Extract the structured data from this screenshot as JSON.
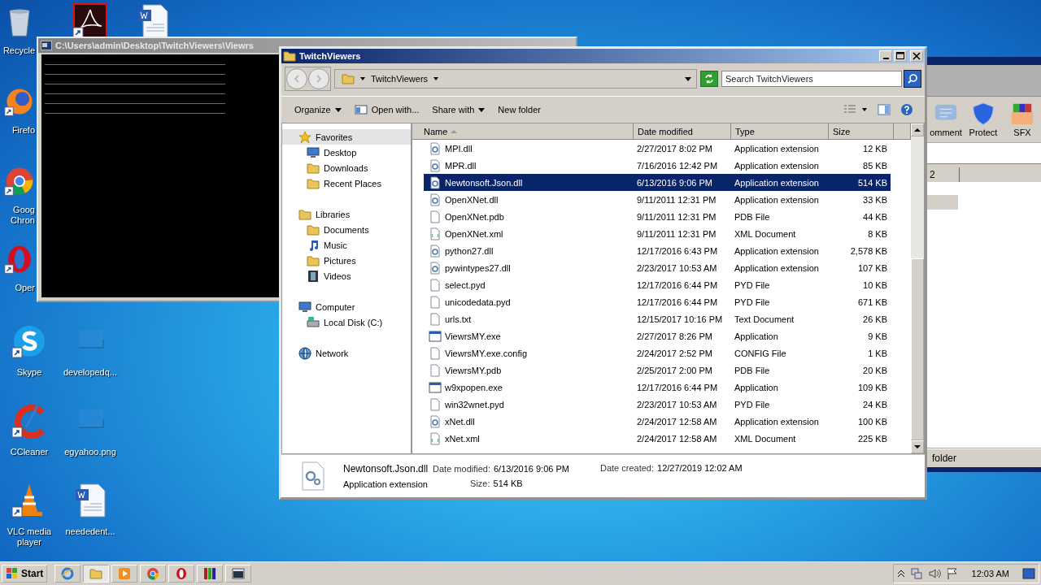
{
  "desktop_icons": [
    {
      "label": "Recycle",
      "kind": "recycle",
      "shortcut": false
    },
    {
      "kind": "pdf",
      "shortcut": true
    },
    {
      "kind": "word",
      "shortcut": false
    },
    {
      "label": "Firefo",
      "kind": "firefox",
      "shortcut": true
    },
    {
      "label": "Goog Chron",
      "kind": "chrome",
      "shortcut": true
    },
    {
      "label": "Oper",
      "kind": "opera",
      "shortcut": true
    },
    {
      "label": "Skype",
      "kind": "skype",
      "shortcut": true
    },
    {
      "label": "developedq...",
      "kind": "blank",
      "shortcut": false
    },
    {
      "label": "CCleaner",
      "kind": "ccleaner",
      "shortcut": true
    },
    {
      "label": "egyahoo.png",
      "kind": "blank",
      "shortcut": false
    },
    {
      "label": "VLC media player",
      "kind": "vlc",
      "shortcut": true
    },
    {
      "label": "neededent...",
      "kind": "word",
      "shortcut": false
    }
  ],
  "console": {
    "title": "C:\\Users\\admin\\Desktop\\TwitchViewers\\Viewrs",
    "lines": [
      "_____________________________________",
      "_____________________________________",
      "_____________________________________",
      "_____________________________________",
      "_____________________________________",
      "_____________________________________"
    ]
  },
  "archiver": {
    "toolbar": [
      {
        "label": "omment",
        "kind": "comment"
      },
      {
        "label": "Protect",
        "kind": "shield"
      },
      {
        "label": "SFX",
        "kind": "box"
      }
    ],
    "column": "2",
    "status": "folder"
  },
  "explorer": {
    "title": "TwitchViewers",
    "address": "TwitchViewers",
    "search": {
      "placeholder": "Search TwitchViewers"
    },
    "toolbar": [
      {
        "label": "Organize",
        "dropdown": true
      },
      {
        "label": "Open with...",
        "dropdown": false
      },
      {
        "label": "Share with",
        "dropdown": true
      },
      {
        "label": "New folder",
        "dropdown": false
      }
    ],
    "sidebar": [
      {
        "label": "Favorites",
        "kind": "star",
        "selected": true,
        "children": [
          {
            "label": "Desktop",
            "kind": "monitor",
            "selected": false
          },
          {
            "label": "Downloads",
            "kind": "folder",
            "selected": false
          },
          {
            "label": "Recent Places",
            "kind": "folder",
            "selected": false
          }
        ]
      },
      {
        "label": "Libraries",
        "kind": "folder",
        "selected": false,
        "children": [
          {
            "label": "Documents",
            "kind": "folder",
            "selected": false
          },
          {
            "label": "Music",
            "kind": "note",
            "selected": false
          },
          {
            "label": "Pictures",
            "kind": "folder",
            "selected": false
          },
          {
            "label": "Videos",
            "kind": "film",
            "selected": false
          }
        ]
      },
      {
        "label": "Computer",
        "kind": "monitor",
        "selected": false,
        "children": [
          {
            "label": "Local Disk (C:)",
            "kind": "drive",
            "selected": false
          }
        ]
      },
      {
        "label": "Network",
        "kind": "globe",
        "selected": false
      }
    ],
    "columns": [
      "Name",
      "Date modified",
      "Type",
      "Size"
    ],
    "rows": [
      {
        "name": "MPI.dll",
        "date": "2/27/2017 8:02 PM",
        "type": "Application extension",
        "size": "12 KB",
        "kind": "dll",
        "selected": false
      },
      {
        "name": "MPR.dll",
        "date": "7/16/2016 12:42 PM",
        "type": "Application extension",
        "size": "85 KB",
        "kind": "dll",
        "selected": false
      },
      {
        "name": "Newtonsoft.Json.dll",
        "date": "6/13/2016 9:06 PM",
        "type": "Application extension",
        "size": "514 KB",
        "kind": "dll",
        "selected": true
      },
      {
        "name": "OpenXNet.dll",
        "date": "9/11/2011 12:31 PM",
        "type": "Application extension",
        "size": "33 KB",
        "kind": "dll",
        "selected": false
      },
      {
        "name": "OpenXNet.pdb",
        "date": "9/11/2011 12:31 PM",
        "type": "PDB File",
        "size": "44 KB",
        "kind": "file",
        "selected": false
      },
      {
        "name": "OpenXNet.xml",
        "date": "9/11/2011 12:31 PM",
        "type": "XML Document",
        "size": "8 KB",
        "kind": "xml",
        "selected": false
      },
      {
        "name": "python27.dll",
        "date": "12/17/2016 6:43 PM",
        "type": "Application extension",
        "size": "2,578 KB",
        "kind": "dll",
        "selected": false
      },
      {
        "name": "pywintypes27.dll",
        "date": "2/23/2017 10:53 AM",
        "type": "Application extension",
        "size": "107 KB",
        "kind": "dll",
        "selected": false
      },
      {
        "name": "select.pyd",
        "date": "12/17/2016 6:44 PM",
        "type": "PYD File",
        "size": "10 KB",
        "kind": "file",
        "selected": false
      },
      {
        "name": "unicodedata.pyd",
        "date": "12/17/2016 6:44 PM",
        "type": "PYD File",
        "size": "671 KB",
        "kind": "file",
        "selected": false
      },
      {
        "name": "urls.txt",
        "date": "12/15/2017 10:16 PM",
        "type": "Text Document",
        "size": "26 KB",
        "kind": "file",
        "selected": false
      },
      {
        "name": "ViewrsMY.exe",
        "date": "2/27/2017 8:26 PM",
        "type": "Application",
        "size": "9 KB",
        "kind": "exe",
        "selected": false
      },
      {
        "name": "ViewrsMY.exe.config",
        "date": "2/24/2017 2:52 PM",
        "type": "CONFIG File",
        "size": "1 KB",
        "kind": "file",
        "selected": false
      },
      {
        "name": "ViewrsMY.pdb",
        "date": "2/25/2017 2:00 PM",
        "type": "PDB File",
        "size": "20 KB",
        "kind": "file",
        "selected": false
      },
      {
        "name": "w9xpopen.exe",
        "date": "12/17/2016 6:44 PM",
        "type": "Application",
        "size": "109 KB",
        "kind": "exe",
        "selected": false
      },
      {
        "name": "win32wnet.pyd",
        "date": "2/23/2017 10:53 AM",
        "type": "PYD File",
        "size": "24 KB",
        "kind": "file",
        "selected": false
      },
      {
        "name": "xNet.dll",
        "date": "2/24/2017 12:58 AM",
        "type": "Application extension",
        "size": "100 KB",
        "kind": "dll",
        "selected": false
      },
      {
        "name": "xNet.xml",
        "date": "2/24/2017 12:58 AM",
        "type": "XML Document",
        "size": "225 KB",
        "kind": "xml",
        "selected": false
      }
    ],
    "details": {
      "name": "Newtonsoft.Json.dll",
      "type": "Application extension",
      "modified_label": "Date modified:",
      "modified": "6/13/2016 9:06 PM",
      "created_label": "Date created:",
      "created": "12/27/2019 12:02 AM",
      "size_label": "Size:",
      "size": "514 KB"
    }
  },
  "taskbar": {
    "start": "Start",
    "buttons": [
      {
        "kind": "ie",
        "selected": false
      },
      {
        "kind": "explorer",
        "selected": true
      },
      {
        "kind": "media",
        "selected": false
      },
      {
        "kind": "chrome",
        "selected": false
      },
      {
        "kind": "opera",
        "selected": false
      },
      {
        "kind": "winrar",
        "selected": false
      },
      {
        "kind": "console",
        "selected": false
      }
    ],
    "clock": "12:03 AM"
  }
}
